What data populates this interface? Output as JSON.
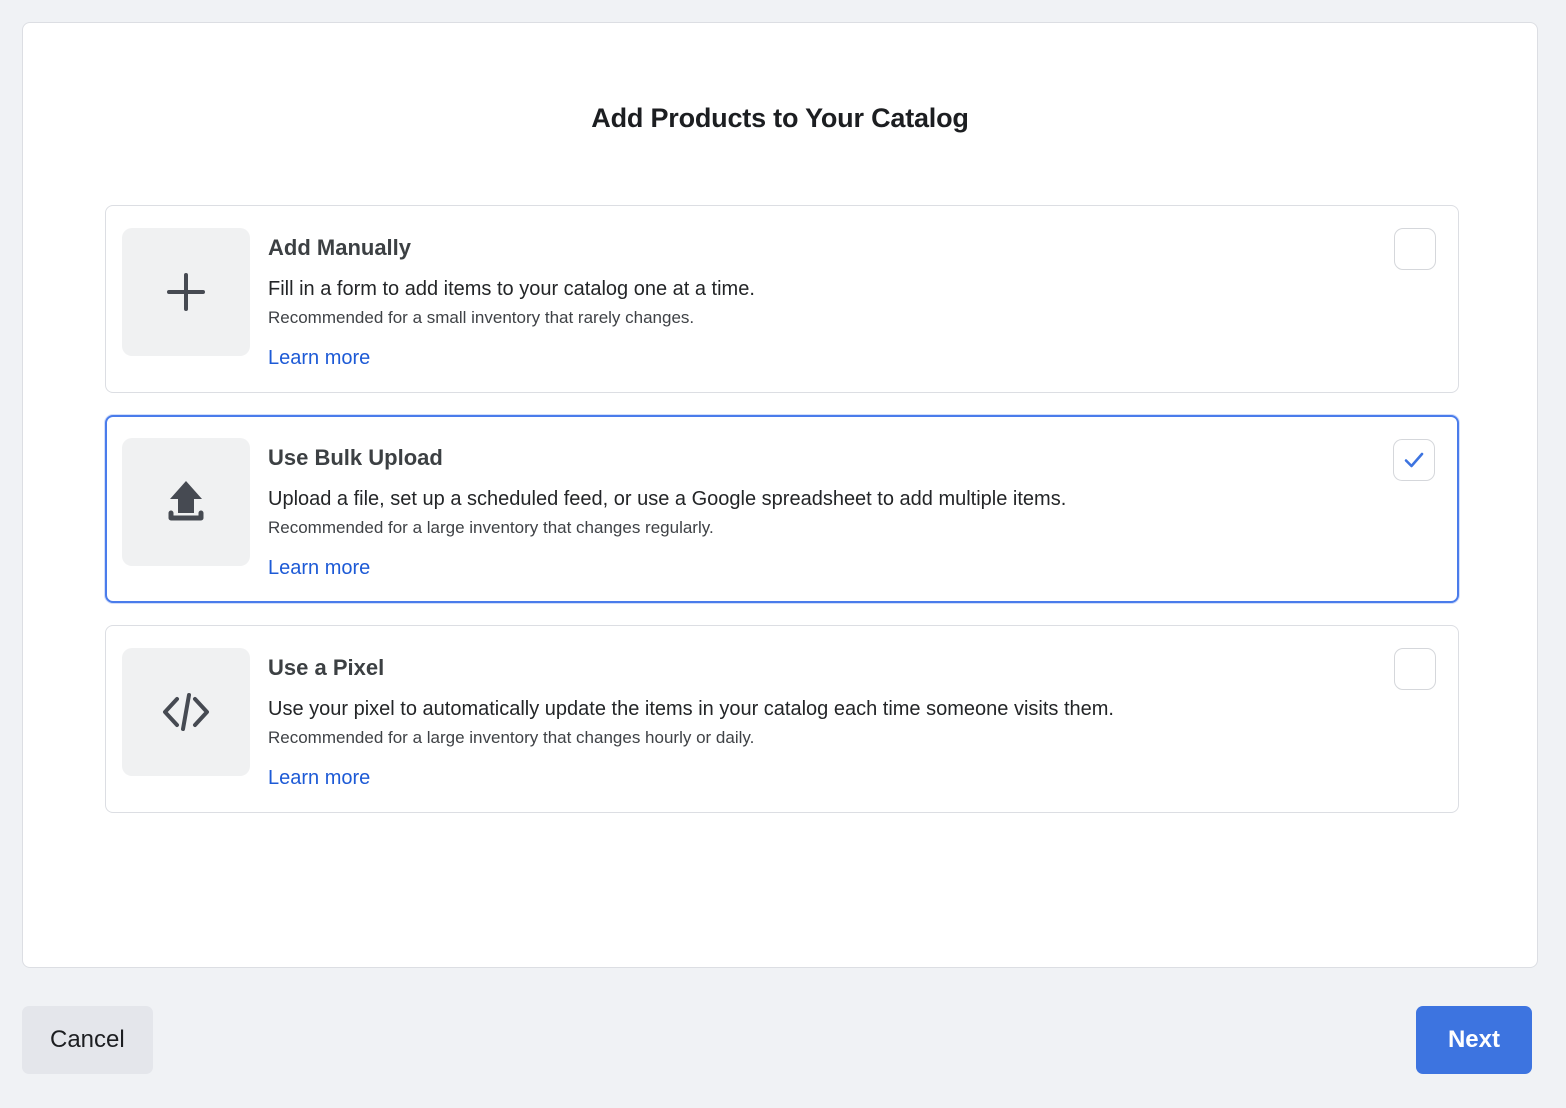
{
  "dialog": {
    "title": "Add Products to Your Catalog"
  },
  "options": [
    {
      "icon": "plus-icon",
      "title": "Add Manually",
      "description": "Fill in a form to add items to your catalog one at a time.",
      "recommendation": "Recommended for a small inventory that rarely changes.",
      "learn_more_label": "Learn more",
      "selected": false
    },
    {
      "icon": "upload-icon",
      "title": "Use Bulk Upload",
      "description": "Upload a file, set up a scheduled feed, or use a Google spreadsheet to add multiple items.",
      "recommendation": "Recommended for a large inventory that changes regularly.",
      "learn_more_label": "Learn more",
      "selected": true
    },
    {
      "icon": "code-icon",
      "title": "Use a Pixel",
      "description": "Use your pixel to automatically update the items in your catalog each time someone visits them.",
      "recommendation": "Recommended for a large inventory that changes hourly or daily.",
      "learn_more_label": "Learn more",
      "selected": false
    }
  ],
  "footer": {
    "cancel_label": "Cancel",
    "next_label": "Next"
  },
  "colors": {
    "page_background": "#f0f2f5",
    "panel_background": "#ffffff",
    "accent_blue": "#3d74e0",
    "link_blue": "#1d5ad6",
    "selected_border": "#4a7ceb",
    "cancel_button": "#e4e6eb",
    "icon_tile": "#f0f1f2",
    "icon_glyph": "#464a52"
  }
}
